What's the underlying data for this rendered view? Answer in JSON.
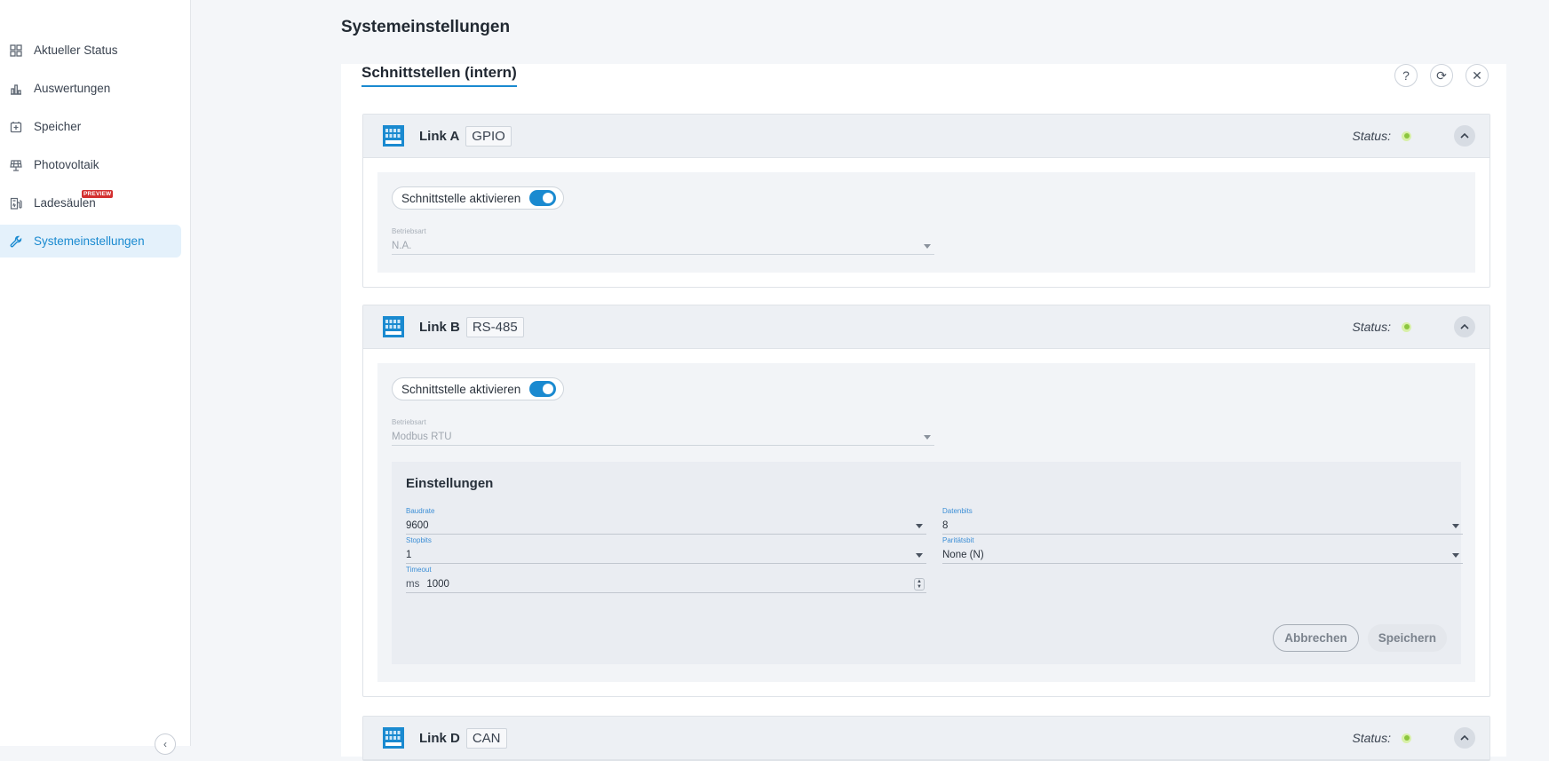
{
  "sidebar": {
    "items": [
      {
        "label": "Aktueller Status",
        "icon": "grid-icon"
      },
      {
        "label": "Auswertungen",
        "icon": "bar-chart-icon"
      },
      {
        "label": "Speicher",
        "icon": "battery-icon"
      },
      {
        "label": "Photovoltaik",
        "icon": "solar-panel-icon"
      },
      {
        "label": "Ladesäulen",
        "icon": "charging-station-icon",
        "badge": "PREVIEW"
      },
      {
        "label": "Systemeinstellungen",
        "icon": "wrench-icon",
        "active": true
      }
    ],
    "collapse_glyph": "‹"
  },
  "page": {
    "title": "Systemeinstellungen"
  },
  "panel": {
    "title": "Schnittstellen (intern)",
    "actions": {
      "help": "?",
      "refresh": "⟳",
      "close": "✕"
    }
  },
  "cards": {
    "a": {
      "name": "Link A",
      "tag": "GPIO",
      "status_label": "Status:",
      "toggle_label": "Schnittstelle aktivieren",
      "toggle_on": true,
      "mode_label": "Betriebsart",
      "mode_value": "N.A."
    },
    "b": {
      "name": "Link B",
      "tag": "RS-485",
      "status_label": "Status:",
      "toggle_label": "Schnittstelle aktivieren",
      "toggle_on": true,
      "mode_label": "Betriebsart",
      "mode_value": "Modbus RTU",
      "settings": {
        "title": "Einstellungen",
        "baudrate_label": "Baudrate",
        "baudrate_value": "9600",
        "datenbits_label": "Datenbits",
        "datenbits_value": "8",
        "stopbits_label": "Stopbits",
        "stopbits_value": "1",
        "paritaet_label": "Paritätsbit",
        "paritaet_value": "None (N)",
        "timeout_label": "Timeout",
        "timeout_unit": "ms",
        "timeout_value": "1000",
        "cancel_label": "Abbrechen",
        "save_label": "Speichern"
      }
    },
    "d": {
      "name": "Link D",
      "tag": "CAN",
      "status_label": "Status:"
    }
  },
  "colors": {
    "accent": "#1a8ad0",
    "status_ok": "#8cc63f",
    "badge": "#d32f2f"
  }
}
